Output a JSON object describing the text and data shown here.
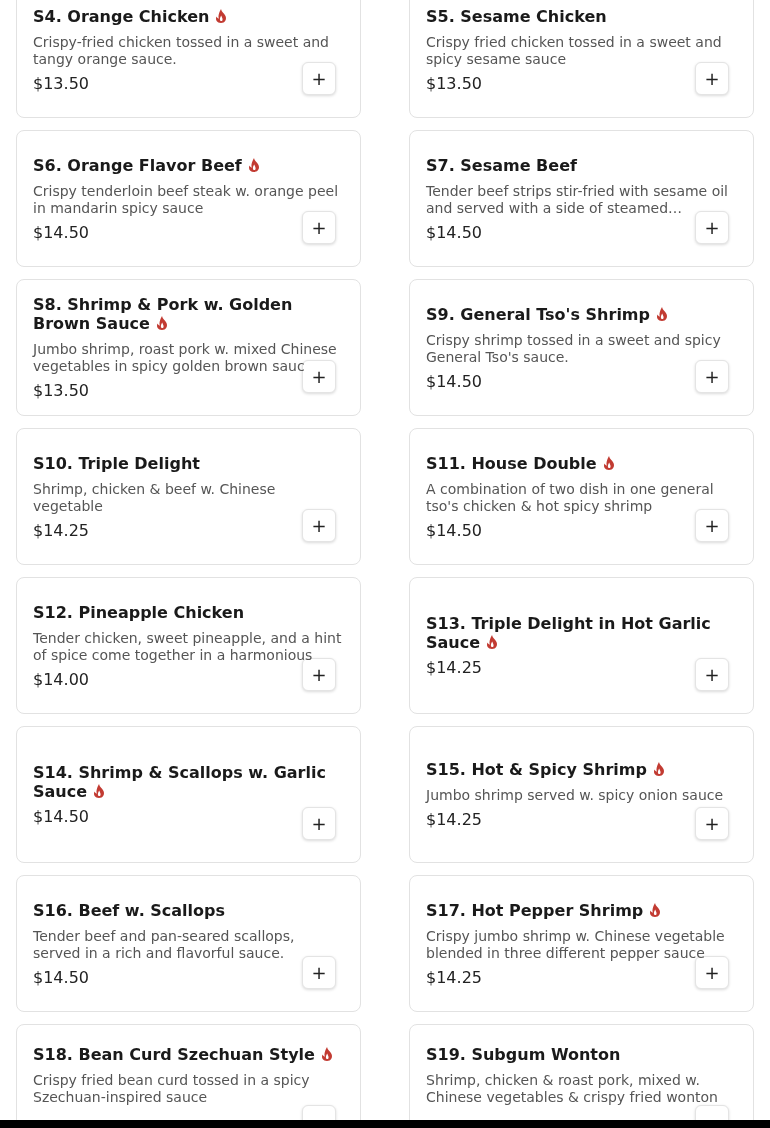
{
  "menu_items": [
    {
      "title": "S4. Orange Chicken",
      "spicy": true,
      "description": "Crispy-fried chicken tossed in a sweet and tangy orange sauce.",
      "price": "$13.50",
      "add_button": "+"
    },
    {
      "title": "S5. Sesame Chicken",
      "spicy": false,
      "description": "Crispy fried chicken tossed in a sweet and spicy sesame sauce",
      "price": "$13.50",
      "add_button": "+"
    },
    {
      "title": "S6. Orange Flavor Beef",
      "spicy": true,
      "description": "Crispy tenderloin beef steak w. orange peel in mandarin spicy sauce",
      "price": "$14.50",
      "add_button": "+"
    },
    {
      "title": "S7. Sesame Beef",
      "spicy": false,
      "description": "Tender beef strips stir-fried with sesame oil and served with a side of steamed…",
      "price": "$14.50",
      "add_button": "+"
    },
    {
      "title": "S8. Shrimp & Pork w. Golden Brown Sauce",
      "spicy": true,
      "description": "Jumbo shrimp, roast pork w. mixed Chinese vegetables in spicy golden brown sauc",
      "price": "$13.50",
      "add_button": "+"
    },
    {
      "title": "S9. General Tso's Shrimp",
      "spicy": true,
      "description": "Crispy shrimp tossed in a sweet and spicy General Tso's sauce.",
      "price": "$14.50",
      "add_button": "+"
    },
    {
      "title": "S10. Triple Delight",
      "spicy": false,
      "description": "Shrimp, chicken & beef w. Chinese vegetable",
      "price": "$14.25",
      "add_button": "+"
    },
    {
      "title": "S11. House Double",
      "spicy": true,
      "description": "A combination of two dish in one general tso's chicken & hot spicy shrimp",
      "price": "$14.50",
      "add_button": "+"
    },
    {
      "title": "S12. Pineapple Chicken",
      "spicy": false,
      "description": "Tender chicken, sweet pineapple, and a hint of spice come together in a harmonious",
      "price": "$14.00",
      "add_button": "+"
    },
    {
      "title": "S13. Triple Delight in Hot Garlic Sauce",
      "spicy": true,
      "price": "$14.25",
      "add_button": "+"
    },
    {
      "title": "S14. Shrimp & Scallops w. Garlic Sauce",
      "spicy": true,
      "price": "$14.50",
      "add_button": "+"
    },
    {
      "title": "S15. Hot & Spicy Shrimp",
      "spicy": true,
      "description": "Jumbo shrimp served w. spicy onion sauce",
      "price": "$14.25",
      "add_button": "+"
    },
    {
      "title": "S16. Beef w. Scallops",
      "spicy": false,
      "description": "Tender beef and pan-seared scallops, served in a rich and flavorful sauce.",
      "price": "$14.50",
      "add_button": "+"
    },
    {
      "title": "S17. Hot Pepper Shrimp",
      "spicy": true,
      "description": "Crispy jumbo shrimp w. Chinese vegetable blended in three different pepper sauce",
      "price": "$14.25",
      "add_button": "+"
    },
    {
      "title": "S18. Bean Curd Szechuan Style",
      "spicy": true,
      "description": "Crispy fried bean curd tossed in a spicy Szechuan-inspired sauce"
    },
    {
      "title": "S19. Subgum Wonton",
      "spicy": false,
      "description": "Shrimp, chicken & roast pork, mixed w. Chinese vegetables & crispy fried wonton"
    }
  ]
}
